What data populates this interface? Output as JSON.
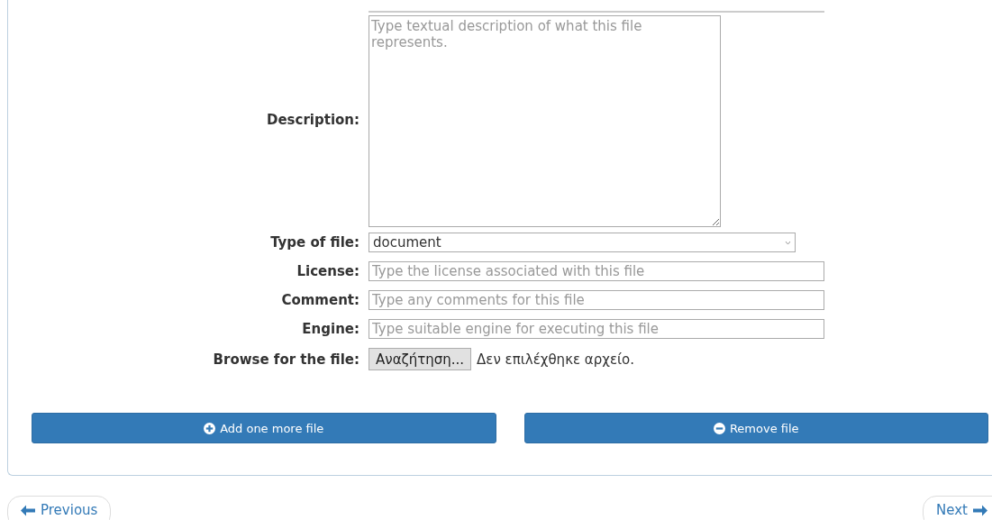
{
  "form": {
    "description": {
      "label": "Description:",
      "placeholder": "Type textual description of what this file represents."
    },
    "type_of_file": {
      "label": "Type of file:",
      "value": "document"
    },
    "license": {
      "label": "License:",
      "placeholder": "Type the license associated with this file"
    },
    "comment": {
      "label": "Comment:",
      "placeholder": "Type any comments for this file"
    },
    "engine": {
      "label": "Engine:",
      "placeholder": "Type suitable engine for executing this file"
    },
    "browse": {
      "label": "Browse for the file:",
      "button": "Αναζήτηση...",
      "status": "Δεν επιλέχθηκε αρχείο."
    }
  },
  "actions": [
    "Add one more file",
    "Remove file"
  ],
  "pager": {
    "previous": "Previous",
    "next": "Next"
  }
}
